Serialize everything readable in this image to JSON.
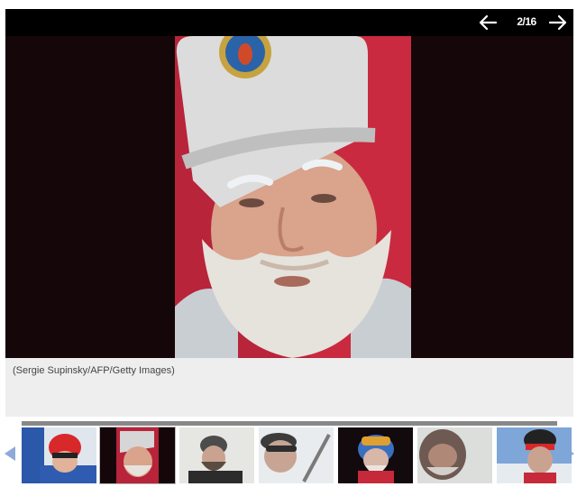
{
  "viewer": {
    "counter": "2/16",
    "prev_icon": "arrow-left-icon",
    "next_icon": "arrow-right-icon",
    "caption": "(Sergie Supinsky/AFP/Getty Images)"
  },
  "thumbnails": {
    "left_icon": "triangle-left-icon",
    "right_icon": "triangle-right-icon",
    "count_visible": 8,
    "active_index": 1
  },
  "colors": {
    "topbar": "#000000",
    "stage": "#140609",
    "panel": "#eeeeee",
    "arrow": "#8fa9d8"
  }
}
